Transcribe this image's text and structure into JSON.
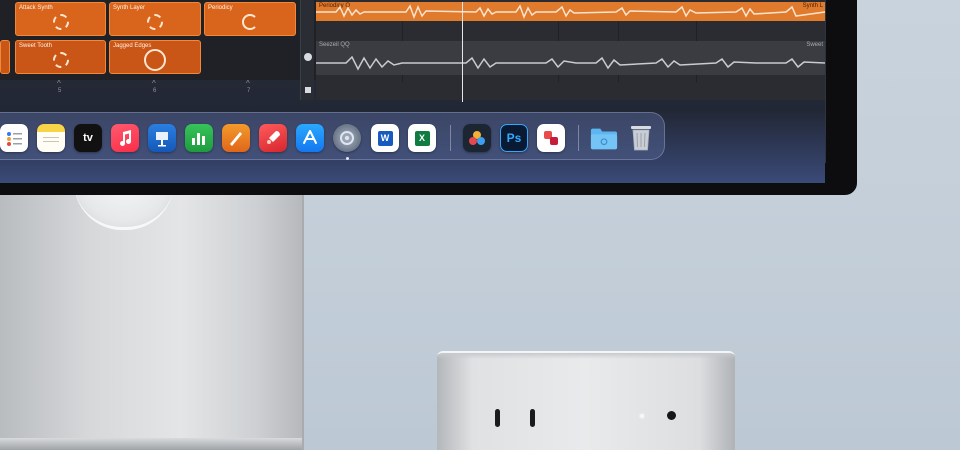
{
  "pads": {
    "row1": [
      {
        "label": "Attack Synth"
      },
      {
        "label": "Synth Layer"
      },
      {
        "label": "Periodicy"
      }
    ],
    "row2": [
      {
        "label": "Sweet Tooth"
      },
      {
        "label": "Jagged Edges"
      }
    ],
    "column_numbers": [
      "5",
      "6",
      "7"
    ]
  },
  "tracks": {
    "orange_label": "Periodicy  Q",
    "orange_end_label": "Synth L",
    "gray_label": "Seezeil  QQ",
    "gray_end_label": "Sweet"
  },
  "dock": {
    "apple_tv_label": "tv",
    "photoshop_label": "Ps",
    "word_label": "W",
    "excel_label": "X"
  }
}
